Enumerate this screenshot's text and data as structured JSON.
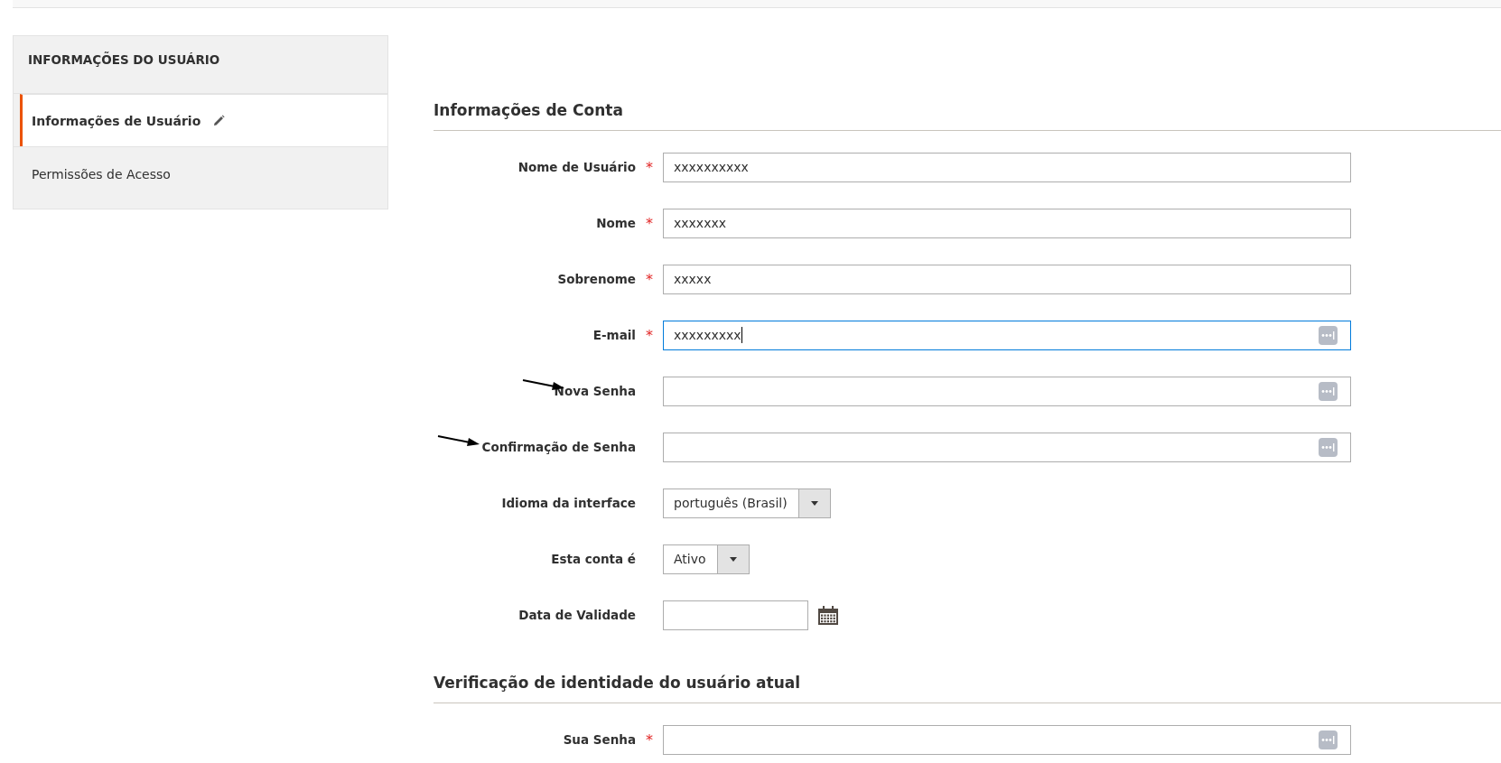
{
  "sidebar": {
    "title": "INFORMAÇÕES DO USUÁRIO",
    "items": [
      {
        "label": "Informações de Usuário",
        "selected": true,
        "edit_icon": true
      },
      {
        "label": "Permissões de Acesso",
        "selected": false,
        "edit_icon": false
      }
    ]
  },
  "sections": [
    {
      "title": "Informações de Conta",
      "fields": [
        {
          "label": "Nome de Usuário",
          "kind": "text",
          "required": "*",
          "value": "xxxxxxxxxx",
          "focused": false,
          "key_icon": false,
          "arrow": false
        },
        {
          "label": "Nome",
          "kind": "text",
          "required": "*",
          "value": "xxxxxxx",
          "focused": false,
          "key_icon": false,
          "arrow": false
        },
        {
          "label": "Sobrenome",
          "kind": "text",
          "required": "*",
          "value": "xxxxx",
          "focused": false,
          "key_icon": false,
          "arrow": false
        },
        {
          "label": "E-mail",
          "kind": "text",
          "required": "*",
          "value": "xxxxxxxxx",
          "focused": true,
          "key_icon": true,
          "arrow": false
        },
        {
          "label": "Nova Senha",
          "kind": "text",
          "focused": false,
          "key_icon": true,
          "arrow": true
        },
        {
          "label": "Confirmação de Senha",
          "kind": "text",
          "focused": false,
          "key_icon": true,
          "arrow": true
        },
        {
          "label": "Idioma da interface",
          "kind": "select",
          "value": "português (Brasil)"
        },
        {
          "label": "Esta conta é",
          "kind": "select",
          "value": "Ativo"
        },
        {
          "label": "Data de Validade",
          "kind": "date"
        }
      ]
    },
    {
      "title": "Verificação de identidade do usuário atual",
      "fields": [
        {
          "label": "Sua Senha",
          "kind": "text",
          "required": "*",
          "focused": false,
          "key_icon": true,
          "arrow": false
        }
      ]
    }
  ]
}
